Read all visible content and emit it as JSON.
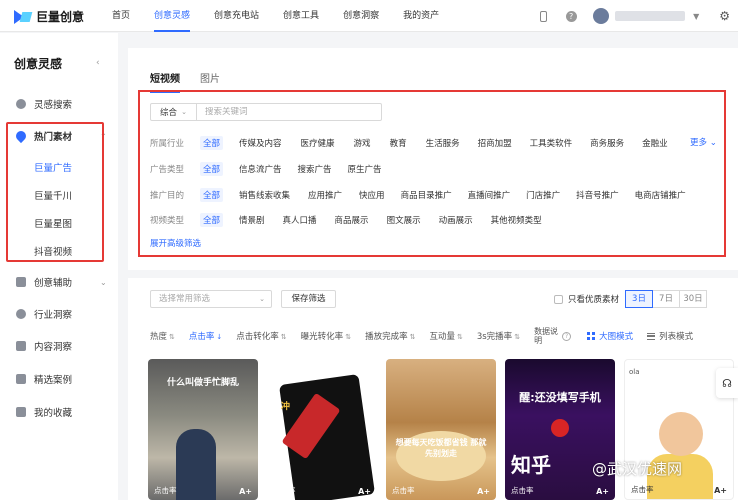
{
  "header": {
    "logo_text": "巨量创意",
    "nav": [
      "首页",
      "创意灵感",
      "创意充电站",
      "创意工具",
      "创意洞察",
      "我的资产"
    ],
    "help_icon": "?"
  },
  "sidebar": {
    "title": "创意灵感",
    "items": [
      {
        "label": "灵感搜索",
        "icon": "search-icon"
      },
      {
        "label": "热门素材",
        "icon": "fire-icon"
      },
      {
        "label": "创意辅助",
        "icon": "assist-icon"
      },
      {
        "label": "行业洞察",
        "icon": "compass-icon"
      },
      {
        "label": "内容洞察",
        "icon": "content-icon"
      },
      {
        "label": "精选案例",
        "icon": "case-icon"
      },
      {
        "label": "我的收藏",
        "icon": "bookmark-icon"
      }
    ],
    "sub_items": [
      "巨量广告",
      "巨量千川",
      "巨量星图",
      "抖音视频"
    ]
  },
  "main": {
    "tabs": [
      "短视频",
      "图片"
    ],
    "search": {
      "select": "综合",
      "placeholder": "搜索关键词"
    },
    "filters": [
      {
        "label": "所属行业",
        "options": [
          "全部",
          "传媒及内容",
          "医疗健康",
          "游戏",
          "教育",
          "生活服务",
          "招商加盟",
          "工具类软件",
          "商务服务",
          "金融业"
        ]
      },
      {
        "label": "广告类型",
        "options": [
          "全部",
          "信息流广告",
          "搜索广告",
          "原生广告"
        ]
      },
      {
        "label": "推广目的",
        "options": [
          "全部",
          "销售线索收集",
          "应用推广",
          "快应用",
          "商品目录推广",
          "直播间推广",
          "门店推广",
          "抖音号推广",
          "电商店铺推广"
        ]
      },
      {
        "label": "视频类型",
        "options": [
          "全部",
          "情景剧",
          "真人口播",
          "商品展示",
          "图文展示",
          "动画展示",
          "其他视频类型"
        ]
      }
    ],
    "more": "更多",
    "advanced": "展开高级筛选",
    "common_filter_placeholder": "选择常用筛选",
    "save_filter": "保存筛选",
    "quality_only": "只看优质素材",
    "days": [
      "3日",
      "7日",
      "30日"
    ],
    "sorts": [
      "热度",
      "点击率",
      "点击转化率",
      "曝光转化率",
      "播放完成率",
      "互动量",
      "3s完播率"
    ],
    "data_desc": "数据说明",
    "views": [
      "大图模式",
      "列表模式"
    ],
    "cards": [
      {
        "caption": "什么叫做手忙脚乱",
        "badge": "点击率",
        "tag": "A+"
      },
      {
        "caption": "冲",
        "badge": "点击率",
        "tag": "A+"
      },
      {
        "caption": "想要每天吃饭都省钱 那就先别划走",
        "badge": "点击率",
        "tag": "A+"
      },
      {
        "caption": "醒:还没填写手机",
        "big": "知乎",
        "badge": "点击率",
        "tag": "A+"
      },
      {
        "mini": "ola",
        "badge": "点击率",
        "tag": "A+"
      }
    ],
    "watermark": "@武汉优速网"
  }
}
